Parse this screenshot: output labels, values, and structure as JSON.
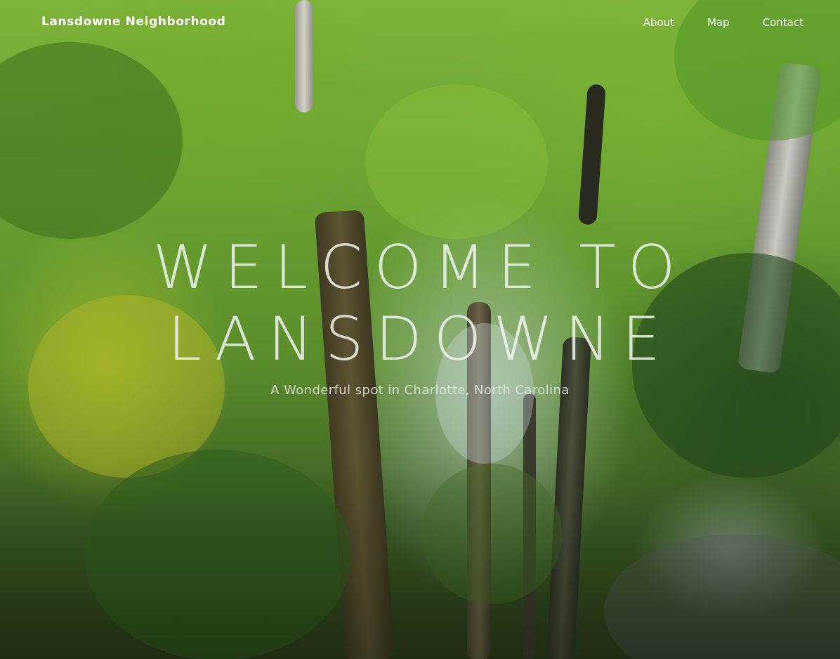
{
  "header": {
    "brand": "Lansdowne Neighborhood",
    "nav": [
      {
        "label": "About"
      },
      {
        "label": "Map"
      },
      {
        "label": "Contact"
      }
    ]
  },
  "hero": {
    "title_line1": "WELCOME TO",
    "title_line2": "LANSDOWNE",
    "subtitle": "A Wonderful spot in Charlotte, North Carolina",
    "background_image": "forest-canopy-photo"
  },
  "colors": {
    "text": "#ffffff",
    "foliage_light": "#7fb23a",
    "foliage_dark": "#2a3a1a"
  }
}
